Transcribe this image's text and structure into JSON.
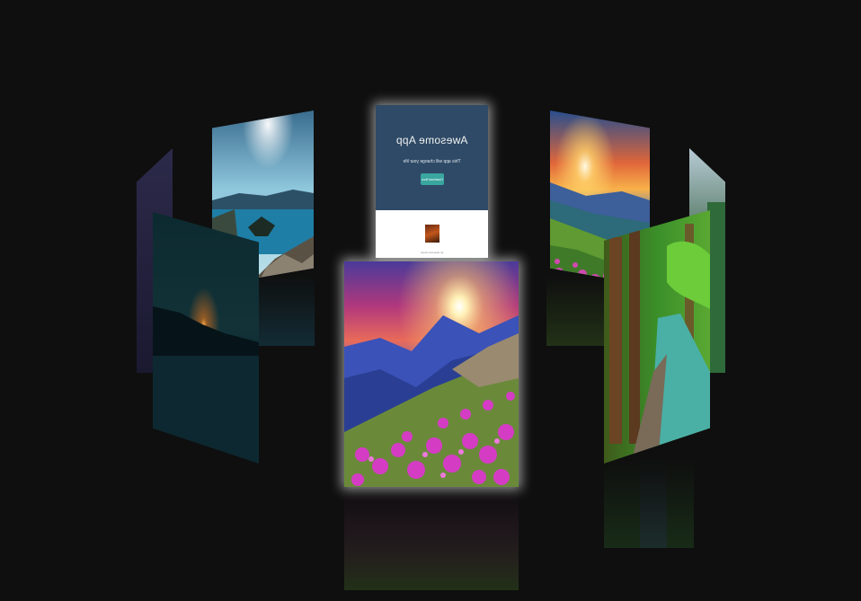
{
  "gallery": {
    "cards": [
      {
        "id": "card-back-far-left",
        "image": "purple-night-sky"
      },
      {
        "id": "card-crater-lake",
        "image": "crater-lake-island"
      },
      {
        "id": "card-awesome-app",
        "image": "app-screenshot"
      },
      {
        "id": "card-sunburst-valley",
        "image": "sunburst-mountain-valley"
      },
      {
        "id": "card-back-far-right",
        "image": "misty-green-cliffs"
      },
      {
        "id": "card-night-lake",
        "image": "night-lake-moonrise"
      },
      {
        "id": "card-flower-mountain-sunrise",
        "image": "magenta-flowers-mountain-sunrise"
      },
      {
        "id": "card-forest-stream",
        "image": "green-forest-stream-path"
      }
    ]
  },
  "app_card": {
    "title": "Awesome App",
    "tagline": "This app will change your life",
    "button": "Download Now",
    "footer": "an awesome footer"
  },
  "colors": {
    "background": "#0f0f0f",
    "app_header": "#2e4a66",
    "app_button": "#3aa6a0",
    "glow": "#ffffff"
  }
}
